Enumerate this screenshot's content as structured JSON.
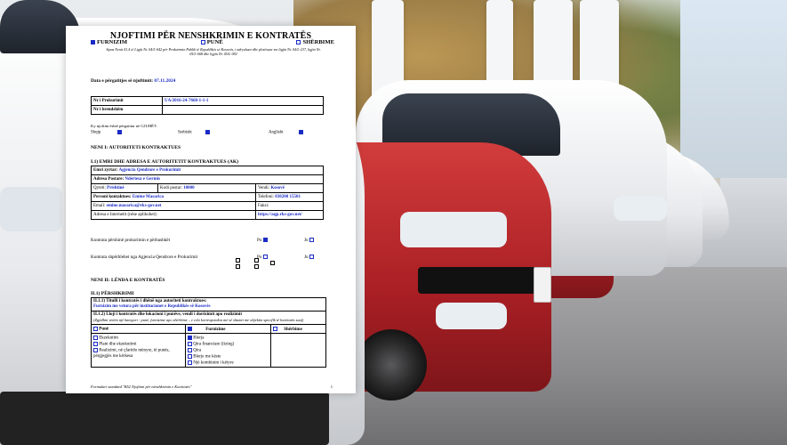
{
  "document": {
    "title": "NJOFTIMI PËR NENSHKRIMIN E KONTRATËS",
    "choices": [
      {
        "label": "FURNIZIM",
        "checked": true
      },
      {
        "label": "PUNË",
        "checked": false
      },
      {
        "label": "SHËRBIME",
        "checked": false
      }
    ],
    "legal_note": "Sipas Nenit 41.4 të Ligjit Nr. 04/L-042 për Prokurimin Publik të Republikës së Kosovës, i ndryshuar dhe plotësuar me ligjin Nr. 04/L-237, ligjin Nr. 05/L-068 dhe ligjin Nr. 05/L-092",
    "date_label": "Data e përgatitjes së njoftimit:",
    "date_value": "07.11.2024",
    "procurement_no_label": "Nr i Prokurimit",
    "procurement_no_value": "UA/2016-24-7668-1-1-1",
    "internal_no_label": "Nr i brendshëm",
    "language_prompt": "Ky njoftim është përgatitur në GJUHËT:",
    "languages": [
      {
        "label": "Shqip",
        "checked": true
      },
      {
        "label": "Serbisht",
        "checked": true
      },
      {
        "label": "Anglisht",
        "checked": true
      }
    ],
    "section1_heading": "NENI I: AUTORITETI KONTRAKTUES",
    "section1_1_heading": "I.1) EMRI DHE ADRESA E AUTORITETIT KONTRAKTUES (AK)",
    "official_name_label": "Emri zyrtar:",
    "official_name_value": "Agjencia Qendrore e Prokurimit",
    "address_label": "Adresa Postare:",
    "address_value": "Ndertesa e Germis",
    "city_label": "Qyteti:",
    "city_value": "Prishtinë",
    "postal_label": "Kodi postar:",
    "postal_value": "10000",
    "country_label": "Vendi:",
    "country_value": "Kosovë",
    "contact_label": "Personi kontaktues:",
    "contact_value": "Emine Masarica",
    "phone_label": "Telefoni:",
    "phone_value": "038200 15501",
    "email_label": "Email:",
    "email_value": "emine.masarica@rks-gov.net",
    "fax_label": "Faksi:",
    "web_label": "Adresa e Internetit (nëse aplikohet):",
    "web_value": "https://aqp.rks-gov.net/",
    "joint_proc_label": "Kontrata përshinë prokurimin e përbashkët",
    "joint_yes": "Po",
    "joint_no": "Jo",
    "central_label": "Kontrata shpërblehet nga Agjencia Qendrore e Prokurimit",
    "central_yes": "Po",
    "central_no": "Jo",
    "section2_heading": "NENI II: LËNDA E KONTRATËS",
    "section2_1_heading": "II.1) PËRSHKRIMI",
    "title_label": "II.1.1) Titulli i kontratës i dhënë nga autoriteti kontraktues:",
    "title_value": "Furnizim me vetura për institucionet e Republikës së Kosovës",
    "type_label": "II.1.2) Lloji i kontratës dhe lokacioni i punëve, vendi i dorëzimit apo realizimit",
    "type_hint": "(Zgjidhni vetëm një kategori - punë, furnizime apo shërbime – e cila korrespondon më së shumti me objektin specifik të kontratës suaj)",
    "columns": [
      {
        "label": "Punë",
        "checked": false
      },
      {
        "label": "Furnizime",
        "checked": true
      },
      {
        "label": "Shërbime",
        "checked": false
      }
    ],
    "works_items": [
      "Ekzekutim",
      "Plani dhe ekzekutimi",
      "Realizimi, në çfarëdo mënyre, të punës, përgjegjës me kërkesa"
    ],
    "supplies_items": [
      {
        "label": "Blerja",
        "checked": true
      },
      {
        "label": "Qira financiare (lizing)",
        "checked": false
      },
      {
        "label": "Qira",
        "checked": false
      },
      {
        "label": "Blerje me këste",
        "checked": false
      },
      {
        "label": "Një kombinim i këtyre",
        "checked": false
      }
    ],
    "footer": "Formulari standard \"B52 Njoftimi për nënshkrimin e Kontratës\"",
    "page_number": "1"
  }
}
